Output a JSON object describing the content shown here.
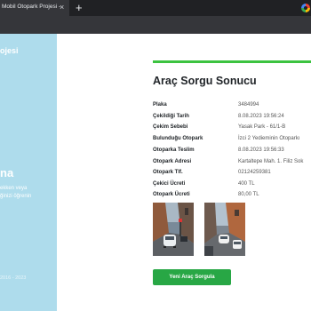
{
  "browser": {
    "tab_title": "Mobil Otopark Projesi -",
    "close_glyph": "×",
    "new_tab_glyph": "+"
  },
  "sidebar": {
    "brand": "ojesi",
    "heading": "na",
    "lines": [
      "ekken veya",
      "ğinizi öğrenin"
    ],
    "footer": "2016 - 2023",
    "background": "#aedcec"
  },
  "result": {
    "progress": 1.0,
    "progress_color": "#3cc340",
    "title": "Araç Sorgu Sonucu",
    "rows": [
      {
        "label": "Plaka",
        "value": "3484994"
      },
      {
        "label": "Çekildiği Tarih",
        "value": "8.08.2023 19:56:24"
      },
      {
        "label": "Çekim Sebebi",
        "value": "Yasak Park - 61/1-B"
      },
      {
        "label": "Bulunduğu Otopark",
        "value": "İzci 2 Yedieminin Otoparkı"
      },
      {
        "label": "Otoparka Teslim",
        "value": "8.08.2023 19:56:33"
      },
      {
        "label": "Otopark Adresi",
        "value": "Kartaltepe Mah. 1. Filiz Sok"
      },
      {
        "label": "Otopark Tlf.",
        "value": "02124259381"
      },
      {
        "label": "Çekici Ücreti",
        "value": "400 TL"
      },
      {
        "label": "Otopark Ücreti",
        "value": "80,00 TL"
      }
    ],
    "button_label": "Yeni Araç Sorgula",
    "button_color": "#28a745"
  }
}
